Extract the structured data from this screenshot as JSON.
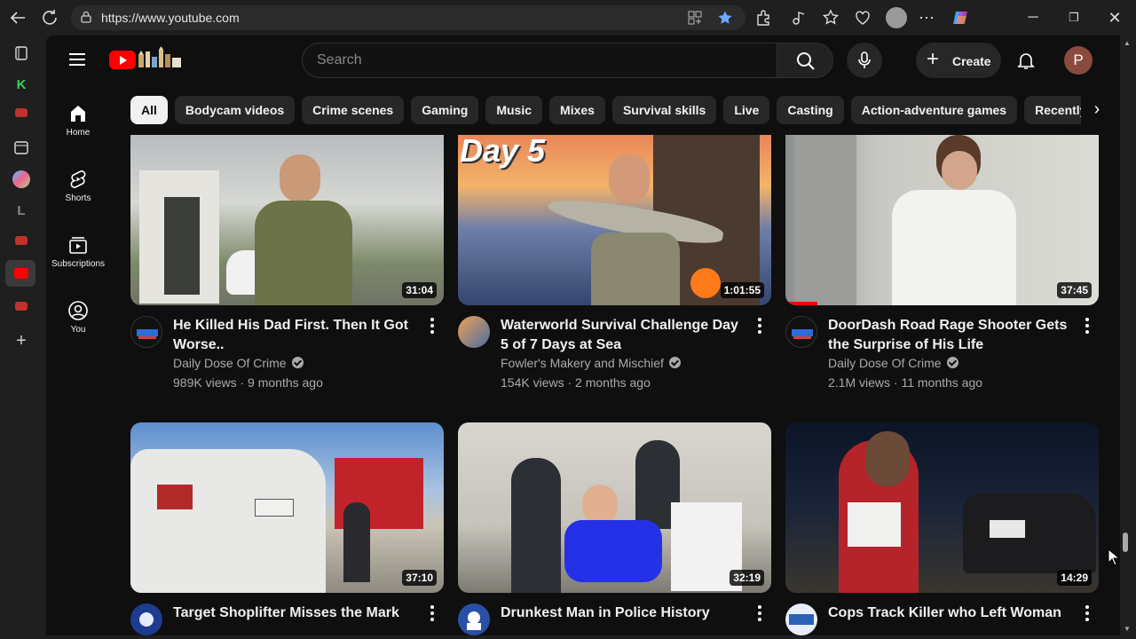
{
  "browser": {
    "url": "https://www.youtube.com"
  },
  "youtube": {
    "search_placeholder": "Search",
    "create_label": "Create",
    "avatar_initial": "P",
    "sidebar": [
      {
        "label": "Home",
        "icon": "home-icon"
      },
      {
        "label": "Shorts",
        "icon": "shorts-icon"
      },
      {
        "label": "Subscriptions",
        "icon": "subscriptions-icon"
      },
      {
        "label": "You",
        "icon": "you-icon"
      }
    ],
    "chips": [
      "All",
      "Bodycam videos",
      "Crime scenes",
      "Gaming",
      "Music",
      "Mixes",
      "Survival skills",
      "Live",
      "Casting",
      "Action-adventure games",
      "Recently"
    ],
    "videos": [
      {
        "title": "He Killed His Dad First. Then It Got Worse..",
        "channel": "Daily Dose Of Crime",
        "meta": "989K views · 9 months ago",
        "duration": "31:04",
        "verified": true
      },
      {
        "title": "Waterworld Survival Challenge Day 5 of 7 Days at Sea",
        "channel": "Fowler's Makery and Mischief",
        "meta": "154K views · 2 months ago",
        "duration": "1:01:55",
        "verified": true,
        "thumb_text": "Day 5"
      },
      {
        "title": "DoorDash Road Rage Shooter Gets the Surprise of His Life",
        "channel": "Daily Dose Of Crime",
        "meta": "2.1M views · 11 months ago",
        "duration": "37:45",
        "verified": true
      },
      {
        "title": "Target Shoplifter Misses the Mark on",
        "duration": "37:10"
      },
      {
        "title": "Drunkest Man in Police History",
        "duration": "32:19"
      },
      {
        "title": "Cops Track Killer who Left Woman in",
        "duration": "14:29"
      }
    ]
  },
  "colors": {
    "yt_red": "#ff0000",
    "background": "#0f0f0f",
    "chrome": "#1f1f1f"
  }
}
